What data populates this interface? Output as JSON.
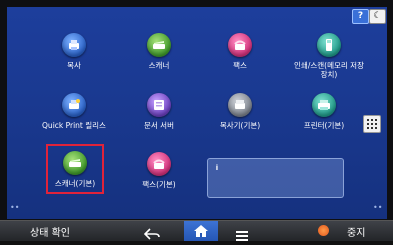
{
  "top": {
    "help": "?",
    "mode": "☾"
  },
  "apps": [
    {
      "label": "복사",
      "icon": "copy-icon",
      "color": "#2a62c9"
    },
    {
      "label": "스캐너",
      "icon": "scanner-icon",
      "color": "#3f9a2a"
    },
    {
      "label": "팩스",
      "icon": "fax-icon",
      "color": "#d2307a"
    },
    {
      "label": "인쇄/스캔(메모리 저장 장치)",
      "label_line1": "인쇄/스캔(메모리 저장",
      "label_line2": "장치)",
      "icon": "usb-memory-icon",
      "color": "#1f9a88"
    },
    {
      "label": "Quick Print 릴리스",
      "icon": "quick-print-icon",
      "color": "#2a62c9"
    },
    {
      "label": "문서 서버",
      "icon": "document-server-icon",
      "color": "#6b3fbf"
    },
    {
      "label": "복사기(기본)",
      "icon": "copier-basic-icon",
      "color": "#7a808a"
    },
    {
      "label": "프린터(기본)",
      "icon": "printer-basic-icon",
      "color": "#1f9a88"
    },
    {
      "label": "스캐너(기본)",
      "icon": "scanner-basic-icon",
      "color": "#3f9a2a"
    },
    {
      "label": "팩스(기본)",
      "icon": "fax-basic-icon",
      "color": "#d2307a"
    }
  ],
  "info": {
    "title": "",
    "message": ""
  },
  "dots": {
    "left": "••",
    "right": "••"
  },
  "bottom": {
    "status": "상태 확인",
    "stop": "중지",
    "back_icon": "back-arrow-icon",
    "home_icon": "home-icon",
    "menu_icon": "menu-icon",
    "stop_icon": "stop-icon"
  }
}
